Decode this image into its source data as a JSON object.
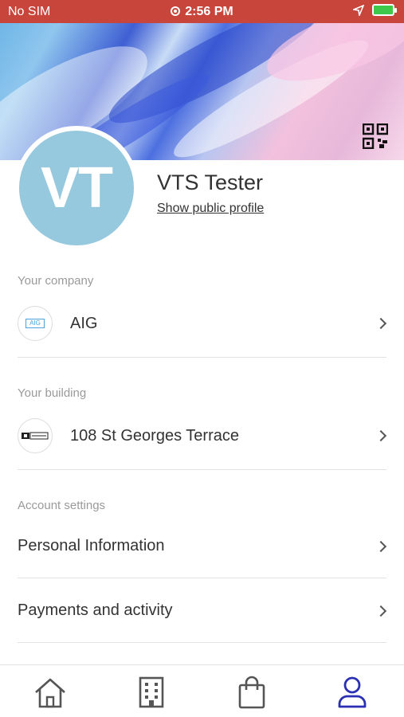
{
  "status_bar": {
    "carrier": "No SIM",
    "time": "2:56 PM"
  },
  "profile": {
    "initials": "VT",
    "name": "VTS Tester",
    "link_label": "Show public profile"
  },
  "company": {
    "section_label": "Your company",
    "name": "AIG",
    "logo_text": "AIG"
  },
  "building": {
    "section_label": "Your building",
    "name": "108 St Georges Terrace"
  },
  "account": {
    "section_label": "Account settings",
    "items": [
      {
        "label": "Personal Information"
      },
      {
        "label": "Payments and activity"
      }
    ]
  },
  "colors": {
    "status_bar": "#c8453b",
    "avatar": "#96c8de",
    "active_tab": "#2a2fb3",
    "inactive_tab": "#555555"
  },
  "tabs": [
    {
      "icon": "home-icon",
      "active": false
    },
    {
      "icon": "building-icon",
      "active": false
    },
    {
      "icon": "bag-icon",
      "active": false
    },
    {
      "icon": "profile-icon",
      "active": true
    }
  ]
}
